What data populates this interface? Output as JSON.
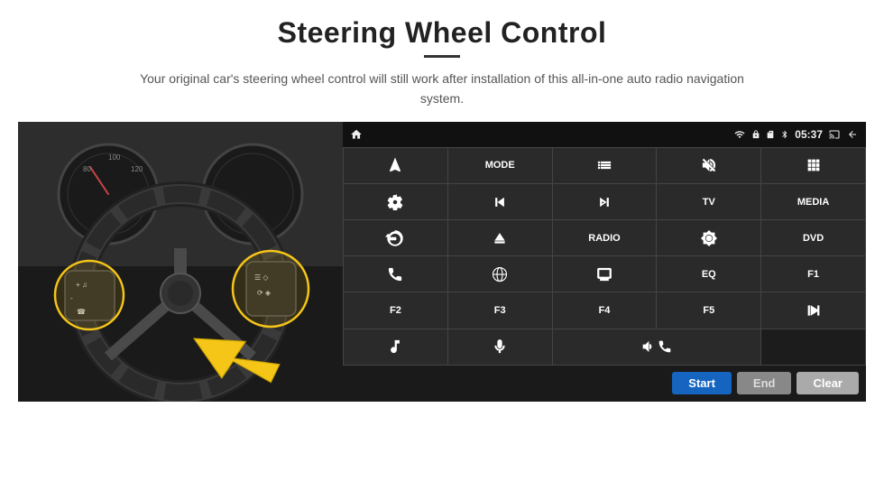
{
  "header": {
    "title": "Steering Wheel Control",
    "subtitle": "Your original car's steering wheel control will still work after installation of this all-in-one auto radio navigation system."
  },
  "status_bar": {
    "time": "05:37",
    "icons": [
      "home",
      "wifi",
      "lock",
      "sd",
      "bluetooth",
      "cast",
      "back"
    ]
  },
  "grid_buttons": [
    {
      "id": "nav",
      "type": "icon",
      "icon": "navigate"
    },
    {
      "id": "mode",
      "type": "text",
      "label": "MODE"
    },
    {
      "id": "list",
      "type": "icon",
      "icon": "list"
    },
    {
      "id": "mute",
      "type": "icon",
      "icon": "mute"
    },
    {
      "id": "apps",
      "type": "icon",
      "icon": "apps"
    },
    {
      "id": "settings",
      "type": "icon",
      "icon": "settings"
    },
    {
      "id": "prev",
      "type": "icon",
      "icon": "prev"
    },
    {
      "id": "next",
      "type": "icon",
      "icon": "next"
    },
    {
      "id": "tv",
      "type": "text",
      "label": "TV"
    },
    {
      "id": "media",
      "type": "text",
      "label": "MEDIA"
    },
    {
      "id": "cam360",
      "type": "icon",
      "icon": "360cam"
    },
    {
      "id": "eject",
      "type": "icon",
      "icon": "eject"
    },
    {
      "id": "radio",
      "type": "text",
      "label": "RADIO"
    },
    {
      "id": "brightness",
      "type": "icon",
      "icon": "brightness"
    },
    {
      "id": "dvd",
      "type": "text",
      "label": "DVD"
    },
    {
      "id": "phone",
      "type": "icon",
      "icon": "phone"
    },
    {
      "id": "browse",
      "type": "icon",
      "icon": "browse"
    },
    {
      "id": "screen",
      "type": "icon",
      "icon": "screen"
    },
    {
      "id": "eq",
      "type": "text",
      "label": "EQ"
    },
    {
      "id": "f1",
      "type": "text",
      "label": "F1"
    },
    {
      "id": "f2",
      "type": "text",
      "label": "F2"
    },
    {
      "id": "f3",
      "type": "text",
      "label": "F3"
    },
    {
      "id": "f4",
      "type": "text",
      "label": "F4"
    },
    {
      "id": "f5",
      "type": "text",
      "label": "F5"
    },
    {
      "id": "playpause",
      "type": "icon",
      "icon": "playpause"
    },
    {
      "id": "music",
      "type": "icon",
      "icon": "music"
    },
    {
      "id": "mic",
      "type": "icon",
      "icon": "mic"
    },
    {
      "id": "volphone",
      "type": "icon",
      "icon": "volphone"
    }
  ],
  "bottom_bar": {
    "start_label": "Start",
    "end_label": "End",
    "clear_label": "Clear"
  }
}
